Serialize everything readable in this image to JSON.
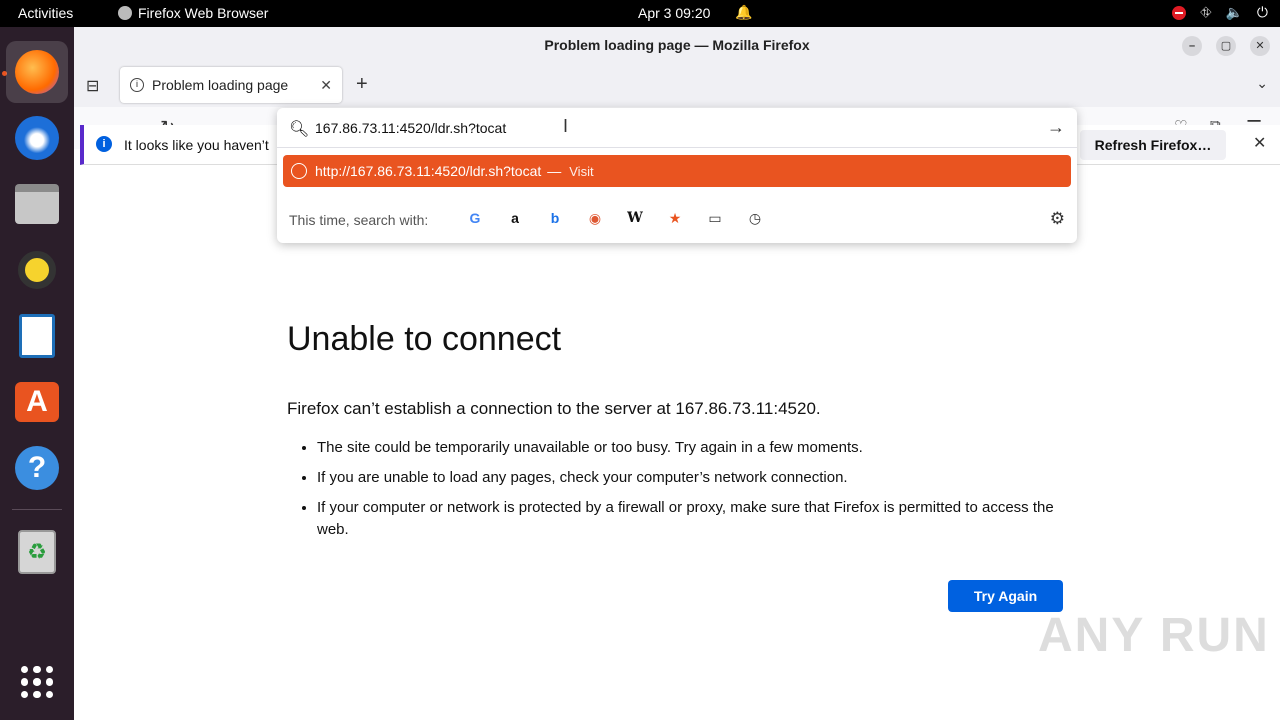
{
  "topbar": {
    "activities": "Activities",
    "app_name": "Firefox Web Browser",
    "date": "Apr 3",
    "time": "09:20"
  },
  "window": {
    "title": "Problem loading page — Mozilla Firefox"
  },
  "tab": {
    "label": "Problem loading page"
  },
  "urlbar": {
    "value": "167.86.73.11:4520/ldr.sh?tocat"
  },
  "suggestion": {
    "url": "http://167.86.73.11:4520/ldr.sh?tocat",
    "separator": "—",
    "action": "Visit",
    "accent": "#e95420"
  },
  "search": {
    "label": "This time, search with:",
    "engines": [
      "google-icon",
      "amazon-icon",
      "bing-icon",
      "duckduckgo-icon",
      "wikipedia-icon",
      "bookmarks-icon",
      "tabs-icon",
      "history-icon"
    ]
  },
  "notification": {
    "text": "It looks like you haven’t",
    "button": "Refresh Firefox…"
  },
  "error": {
    "title": "Unable to connect",
    "lead": "Firefox can’t establish a connection to the server at 167.86.73.11:4520.",
    "bullets": [
      "The site could be temporarily unavailable or too busy. Try again in a few moments.",
      "If you are unable to load any pages, check your computer’s network connection.",
      "If your computer or network is protected by a firewall or proxy, make sure that Firefox is permitted to access the web."
    ],
    "button": "Try Again"
  },
  "watermark": "ANY RUN"
}
